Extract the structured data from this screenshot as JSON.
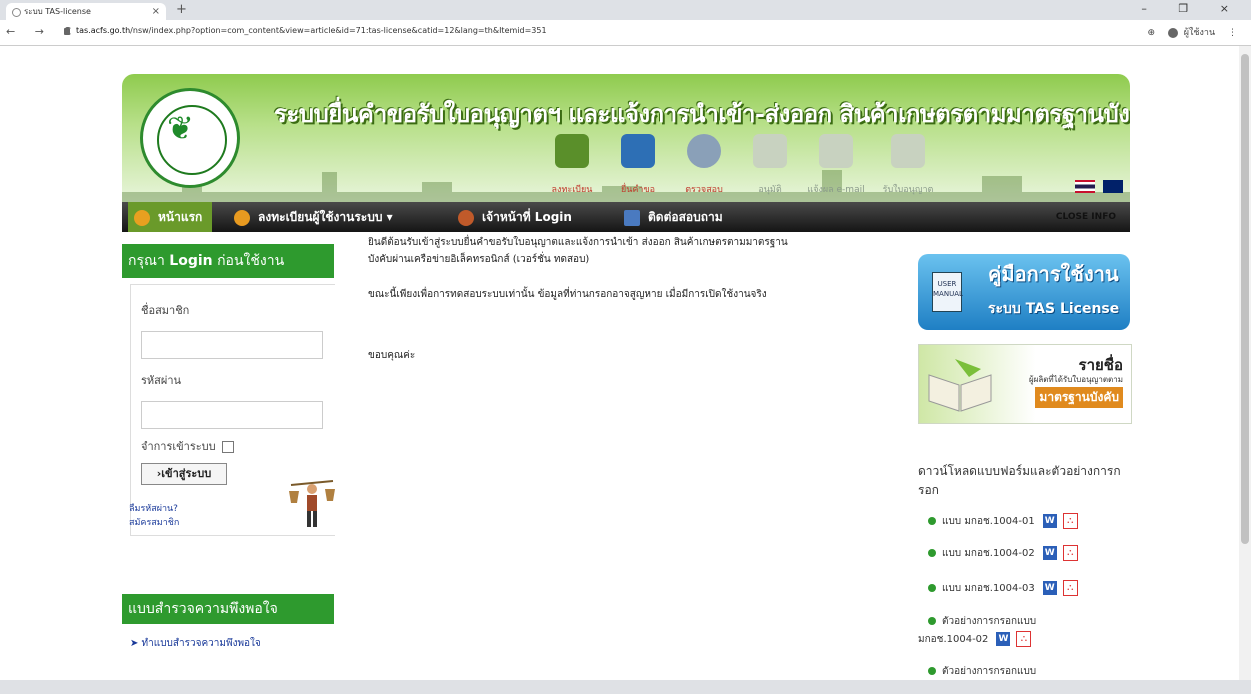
{
  "browser": {
    "tab_title": "ระบบ TAS-license",
    "tab_close": "×",
    "new_tab": "+",
    "window_controls": "– ❐ ×",
    "nav_icons": "← → C",
    "url_host": "tas.acfs.go.th",
    "url_path": "/nsw/index.php?option=com_content&view=article&id=71:tas-license&catid=12&lang=th&Itemid=351",
    "profile_label": "ผู้ใช้งาน",
    "menu_glyph": "⋮",
    "zoom_glyph": "⊕"
  },
  "banner": {
    "title": "ระบบยื่นคำขอรับใบอนุญาตฯ และแจ้งการนำเข้า-ส่งออก สินค้าเกษตรตามมาตรฐานบังคับ",
    "steps": [
      {
        "label": "ลงทะเบียน",
        "color": "#5a8f2a"
      },
      {
        "label": "ยื่นคำขอ",
        "color": "#2d6fb5"
      },
      {
        "label": "ตรวจสอบ",
        "color": "#8aa0b8"
      },
      {
        "label": "อนุมัติ",
        "color": "#c8d2c0"
      },
      {
        "label": "แจ้งผล e-mail",
        "color": "#c8d2c0"
      },
      {
        "label": "รับใบอนุญาต",
        "color": "#c8d2c0"
      }
    ]
  },
  "menu": {
    "items": [
      {
        "label": "หน้าแรก"
      },
      {
        "label": "ลงทะเบียนผู้ใช้งานระบบ ▾"
      },
      {
        "label": "เจ้าหน้าที่ Login"
      },
      {
        "label": "ติดต่อสอบถาม"
      }
    ],
    "close_info": "CLOSE INFO"
  },
  "login": {
    "title_prefix": "กรุณา ",
    "title_bold": "Login",
    "title_suffix": " ก่อนใช้งาน",
    "username_label": "ชื่อสมาชิก",
    "username_value": "",
    "password_label": "รหัสผ่าน",
    "password_value": "",
    "remember_label": "จำการเข้าระบบ",
    "submit_label": "›เข้าสู่ระบบ",
    "forgot_link": "ลืมรหัสผ่าน?",
    "register_link": "สมัครสมาชิก"
  },
  "survey": {
    "title": "แบบสำรวจความพึงพอใจ",
    "link": "➤ ทำแบบสำรวจความพึงพอใจ"
  },
  "content": {
    "welcome_1": "ยินดีต้อนรับเข้าสู่ระบบยื่นคำขอรับใบอนุญาตและแจ้งการนำเข้า ส่งออก สินค้าเกษตรตามมาตรฐาน",
    "welcome_2": "บังคับผ่านเครือข่ายอิเล็คทรอนิกส์ (เวอร์ชั่น ทดสอบ)",
    "notice": "ขณะนี้เพียงเพื่อการทดสอบระบบเท่านั้น ข้อมูลที่ท่านกรอกอาจสูญหาย เมื่อมีการเปิดใช้งานจริง",
    "thanks": "ขอบคุณค่ะ"
  },
  "sidebar_right": {
    "manual_book": "USER MANUAL",
    "manual_title": "คู่มือการใช้งาน",
    "manual_subtitle": "ระบบ TAS License",
    "approved_title": "รายชื่อ",
    "approved_sub": "ผู้ผลิตที่ได้รับใบอนุญาตตาม",
    "approved_tag": "มาตรฐานบังคับ",
    "downloads_title": "ดาวน์โหลดแบบฟอร์มและตัวอย่างการกรอก",
    "downloads": [
      {
        "label": "แบบ มกอช.1004-01"
      },
      {
        "label": "แบบ มกอช.1004-02"
      },
      {
        "label": "แบบ มกอช.1004-03"
      },
      {
        "label": "ตัวอย่างการกรอกแบบ",
        "label2": "มกอช.1004-02"
      },
      {
        "label": "ตัวอย่างการกรอกแบบ"
      }
    ],
    "word_icon": "W",
    "pdf_icon": "⛬"
  }
}
